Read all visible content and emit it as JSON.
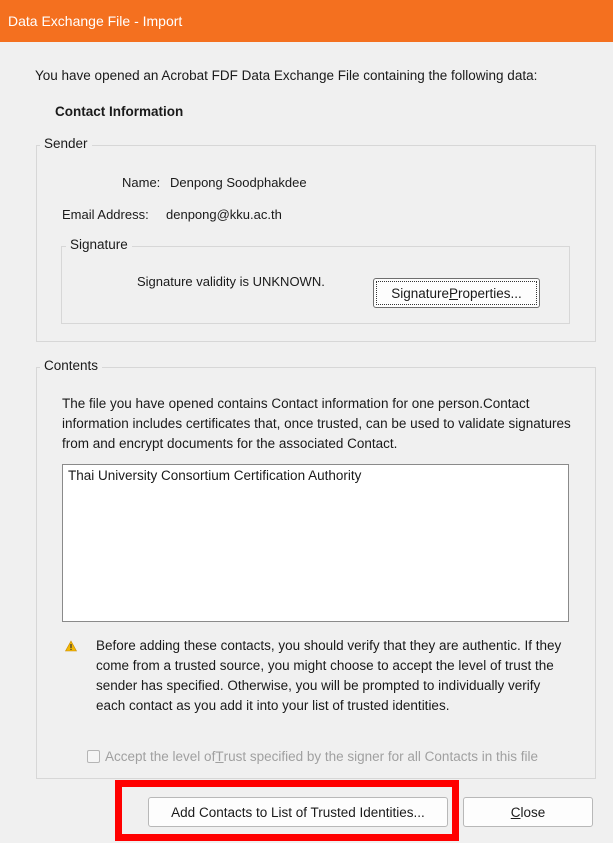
{
  "window": {
    "title": "Data Exchange File - Import"
  },
  "intro": "You have opened an Acrobat FDF Data Exchange File containing the following data:",
  "section_title": "Contact Information",
  "sender": {
    "legend": "Sender",
    "name_label": "Name:",
    "name_value": "Denpong Soodphakdee",
    "email_label": "Email Address:",
    "email_value": "denpong@kku.ac.th",
    "signature": {
      "legend": "Signature",
      "status": "Signature validity is UNKNOWN.",
      "button_label": "Signature Properties...",
      "button_label_pre": "Signature ",
      "button_label_accel": "P",
      "button_label_post": "roperties..."
    }
  },
  "contents": {
    "legend": "Contents",
    "description": "The file you have opened contains Contact information for one person.Contact information includes certificates that, once trusted, can be used to validate signatures from and encrypt documents for the associated Contact.",
    "items": [
      "Thai University Consortium Certification Authority"
    ],
    "warning": "Before adding these contacts, you should verify that they are authentic. If they come from a trusted source, you might choose to accept the level of trust the sender has specified. Otherwise, you will be prompted to individually verify each contact as you add it into your list of trusted identities.",
    "warning_icon": "warning-triangle-icon",
    "accept_checkbox": {
      "label": "Accept the level of Trust specified by the signer for all Contacts in this file",
      "label_pre": "Accept the level of ",
      "label_accel": "T",
      "label_post": "rust specified by the signer for all Contacts in this file",
      "checked": false,
      "enabled": false
    }
  },
  "buttons": {
    "add_contacts": "Add Contacts to List of Trusted Identities...",
    "close": "Close",
    "close_accel": "C",
    "close_post": "lose"
  },
  "colors": {
    "titlebar": "#f4701f",
    "highlight": "#ff0000",
    "dialog_bg": "#f0f0f0"
  }
}
